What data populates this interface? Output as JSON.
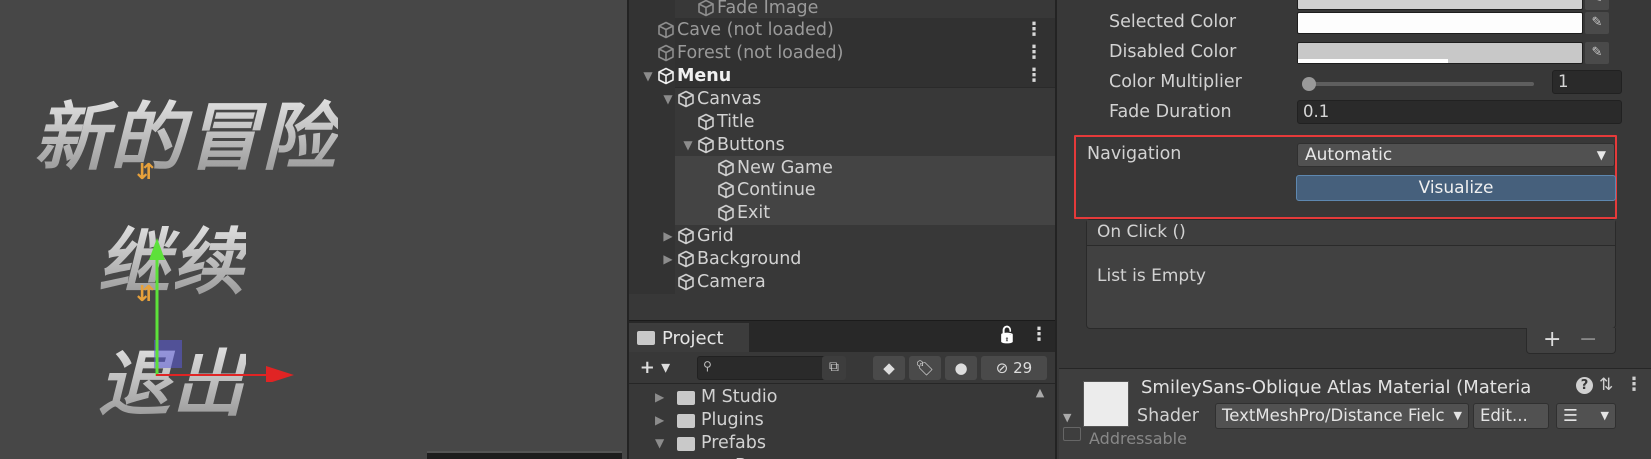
{
  "scene": {
    "title_text": "新的冒险",
    "continue_text": "继续",
    "exit_text": "退出",
    "nav_arrow_glyph": "⇵"
  },
  "hierarchy": {
    "rows": [
      {
        "label": "Fade Image",
        "kind": "object",
        "dim": true
      },
      {
        "label": "Cave (not loaded)",
        "kind": "scene",
        "dim": true
      },
      {
        "label": "Forest (not loaded)",
        "kind": "scene",
        "dim": true
      },
      {
        "label": "Menu",
        "kind": "scene",
        "bold": true
      },
      {
        "label": "Canvas",
        "kind": "object"
      },
      {
        "label": "Title",
        "kind": "object"
      },
      {
        "label": "Buttons",
        "kind": "object"
      },
      {
        "label": "New Game",
        "kind": "object",
        "selected": true
      },
      {
        "label": "Continue",
        "kind": "object",
        "selected": true
      },
      {
        "label": "Exit",
        "kind": "object",
        "selected": true
      },
      {
        "label": "Grid",
        "kind": "object"
      },
      {
        "label": "Background",
        "kind": "object"
      },
      {
        "label": "Camera",
        "kind": "object"
      }
    ],
    "kebab_glyph": "⋮"
  },
  "project": {
    "tab_label": "Project",
    "lock_glyph": "🔓",
    "kebab_glyph": "⋮",
    "add_label": "+ ▾",
    "hidden_count": "29",
    "search_placeholder": "",
    "folders": [
      {
        "label": "M Studio",
        "expanded": false
      },
      {
        "label": "Plugins",
        "expanded": false
      },
      {
        "label": "Prefabs",
        "expanded": true
      },
      {
        "label": "Box",
        "expanded": false
      }
    ]
  },
  "inspector": {
    "selected_color_label": "Selected Color",
    "disabled_color_label": "Disabled Color",
    "color_multiplier_label": "Color Multiplier",
    "color_multiplier_value": "1",
    "color_multiplier_fraction": 0.0,
    "fade_duration_label": "Fade Duration",
    "fade_duration_value": "0.1",
    "navigation_label": "Navigation",
    "navigation_value": "Automatic",
    "visualize_label": "Visualize",
    "onclick_label": "On Click ()",
    "list_empty_label": "List is Empty",
    "add_glyph": "+",
    "remove_glyph": "−",
    "material_title": "SmileySans-Oblique Atlas Material (Materia",
    "shader_label": "Shader",
    "shader_value": "TextMeshPro/Distance Fielc",
    "edit_label": "Edit...",
    "addressable_label": "Addressable",
    "help_glyph": "?",
    "settings_glyph": "⇅",
    "kebab_glyph": "⋮"
  },
  "colors": {
    "highlight_red": "#e53a3a",
    "visualize_blue": "#46607c",
    "nav_arrow_orange": "#e7a13b",
    "gizmo_green": "#5de13a",
    "gizmo_red": "#e02424"
  }
}
